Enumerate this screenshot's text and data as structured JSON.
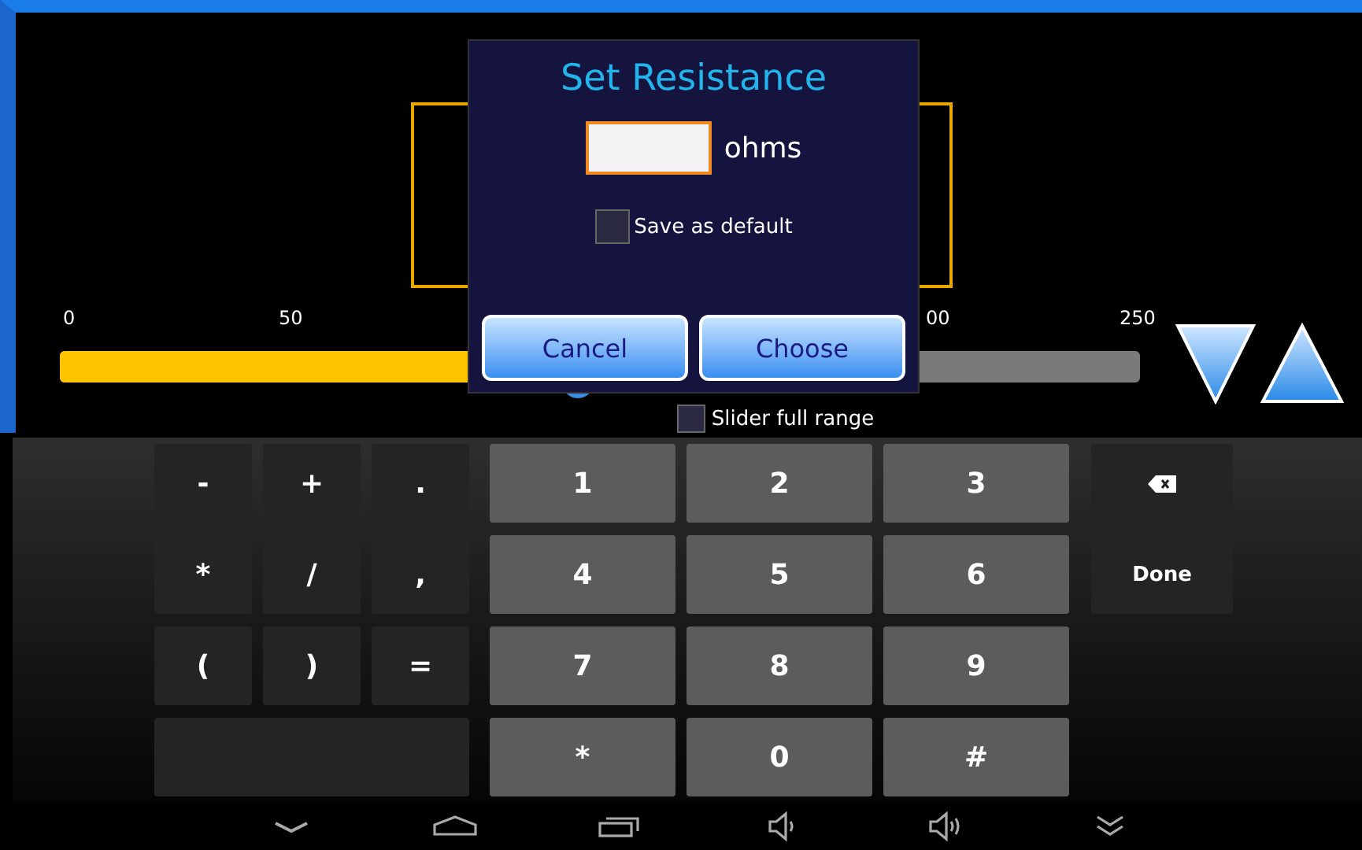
{
  "screen": {
    "slider": {
      "ticks": [
        "0",
        "50",
        "00",
        "250"
      ],
      "level": 0.48
    },
    "full_range": {
      "label": "Slider full range",
      "checked": false
    }
  },
  "dialog": {
    "title": "Set Resistance",
    "field": {
      "unit": "ohms"
    },
    "save_default": {
      "label": "Save as default",
      "checked": false
    },
    "buttons": [
      "Cancel",
      "Choose"
    ]
  },
  "keyboard": {
    "symbol_keys": [
      "-",
      "+",
      ".",
      "*",
      "/",
      ",",
      "(",
      ")",
      "="
    ],
    "digit_keys": [
      "1",
      "2",
      "3",
      "4",
      "5",
      "6",
      "7",
      "8",
      "9",
      "*",
      "0",
      "#"
    ],
    "done": "Done"
  }
}
